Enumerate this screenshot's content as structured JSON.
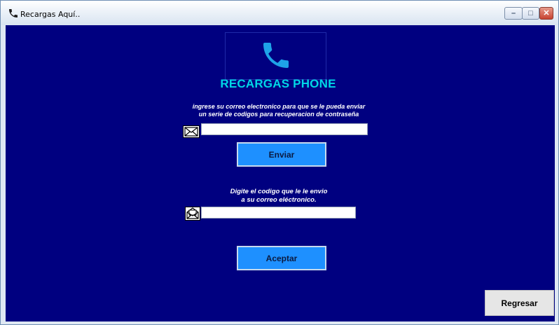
{
  "window": {
    "title": "Recargas Aquí..",
    "controls": {
      "minimize_icon": "minimize-icon",
      "maximize_icon": "maximize-icon",
      "close_icon": "close-icon"
    }
  },
  "logo": {
    "icon": "phone-icon",
    "color": "#1ea3e8"
  },
  "brand": {
    "title": "RECARGAS PHONE",
    "color": "#00d7e6"
  },
  "recovery": {
    "instruction_line1": "ingrese su correo electronico para que se le pueda enviar",
    "instruction_line2": "un serie de codigos para recuperacion de contraseña",
    "email_icon": "envelope-icon",
    "email_value": "",
    "send_label": "Enviar"
  },
  "verify": {
    "instruction_line1": "Digite el codigo que le le envio",
    "instruction_line2": "a su correo eléctronico.",
    "code_icon": "open-envelope-icon",
    "code_value": "",
    "accept_label": "Aceptar"
  },
  "footer": {
    "back_label": "Regresar"
  },
  "colors": {
    "background": "#000080",
    "button_blue": "#1e90ff",
    "button_gray": "#e6e6e6"
  }
}
